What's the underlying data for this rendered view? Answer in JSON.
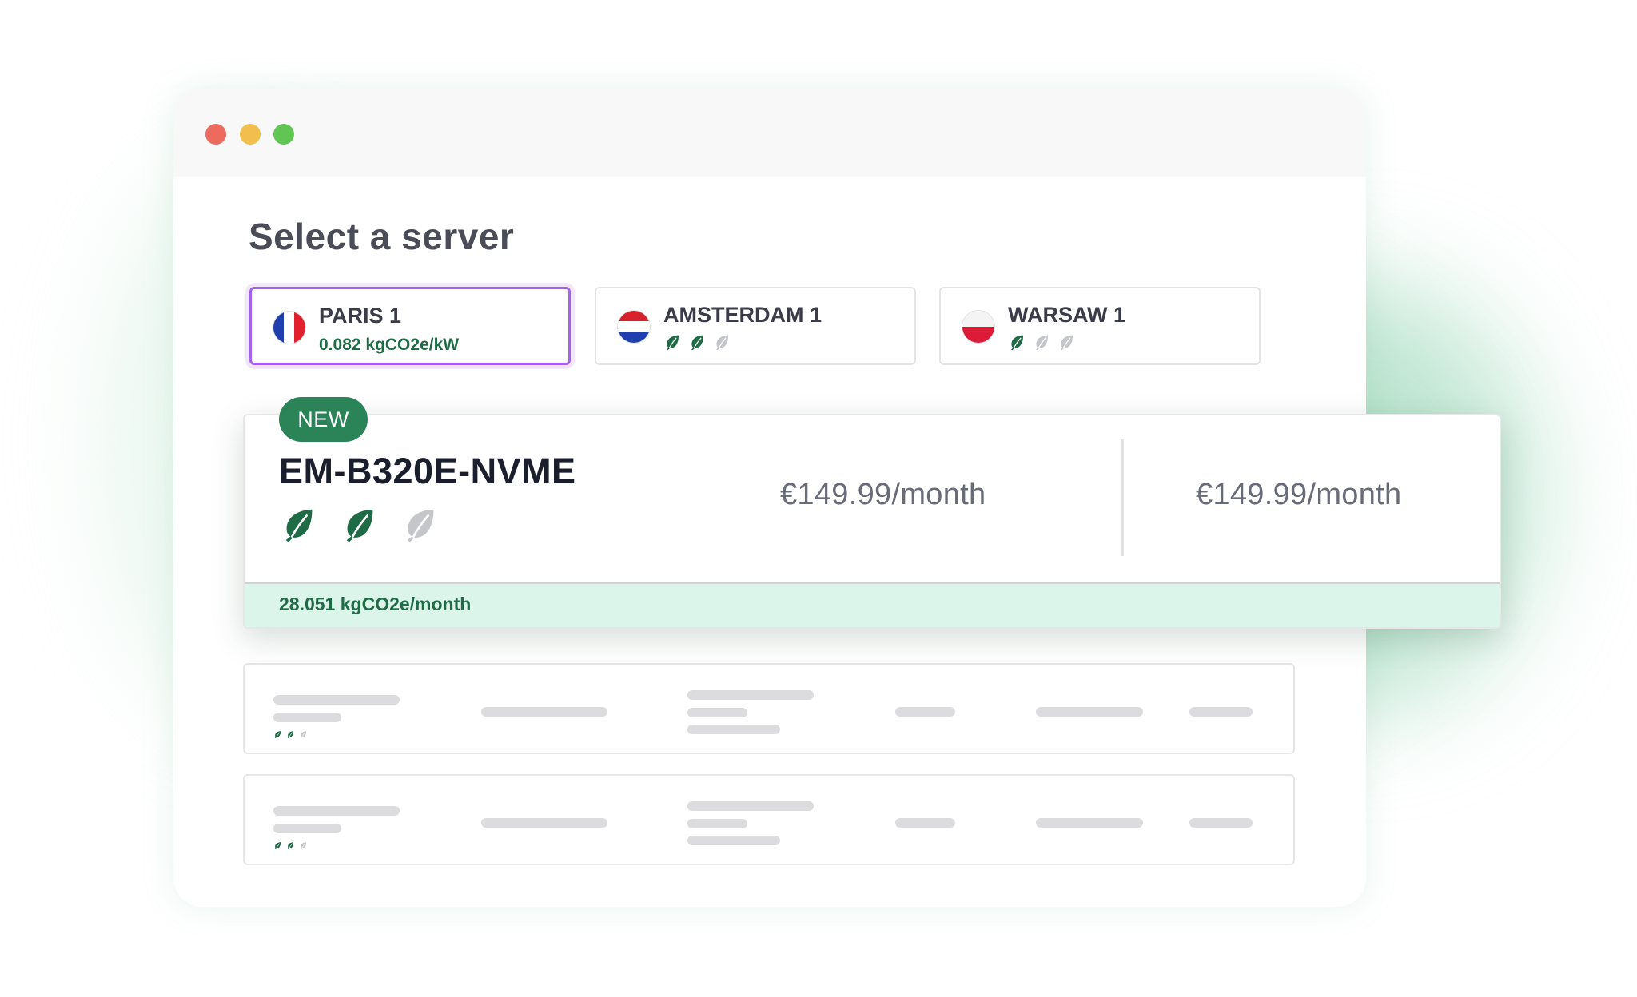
{
  "window": {
    "controls": [
      {
        "name": "close",
        "color": "#ec6a5e"
      },
      {
        "name": "minimize",
        "color": "#f2bf4f"
      },
      {
        "name": "maximize",
        "color": "#61c554"
      }
    ]
  },
  "page": {
    "title": "Select a server"
  },
  "colors": {
    "eco_green": "#1f6b45",
    "leaf_inactive": "#c4c6ca",
    "selected_border": "#a561ea",
    "badge_green": "#2a8457"
  },
  "regions": [
    {
      "name": "PARIS 1",
      "co2": "0.082 kgCO2e/kW",
      "flag": "france",
      "selected": true,
      "eco_rating": null
    },
    {
      "name": "AMSTERDAM 1",
      "co2": null,
      "flag": "netherlands",
      "selected": false,
      "eco_rating": 2
    },
    {
      "name": "WARSAW 1",
      "co2": null,
      "flag": "poland",
      "selected": false,
      "eco_rating": 1
    }
  ],
  "featured": {
    "badge": "NEW",
    "server_name": "EM-B320E-NVME",
    "eco_rating": 2,
    "eco_max": 3,
    "price_1": "€149.99/month",
    "price_2": "€149.99/month",
    "co2": "28.051 kgCO2e/month"
  },
  "placeholder_rows": [
    {
      "eco_rating": 2
    },
    {
      "eco_rating": 2
    }
  ]
}
